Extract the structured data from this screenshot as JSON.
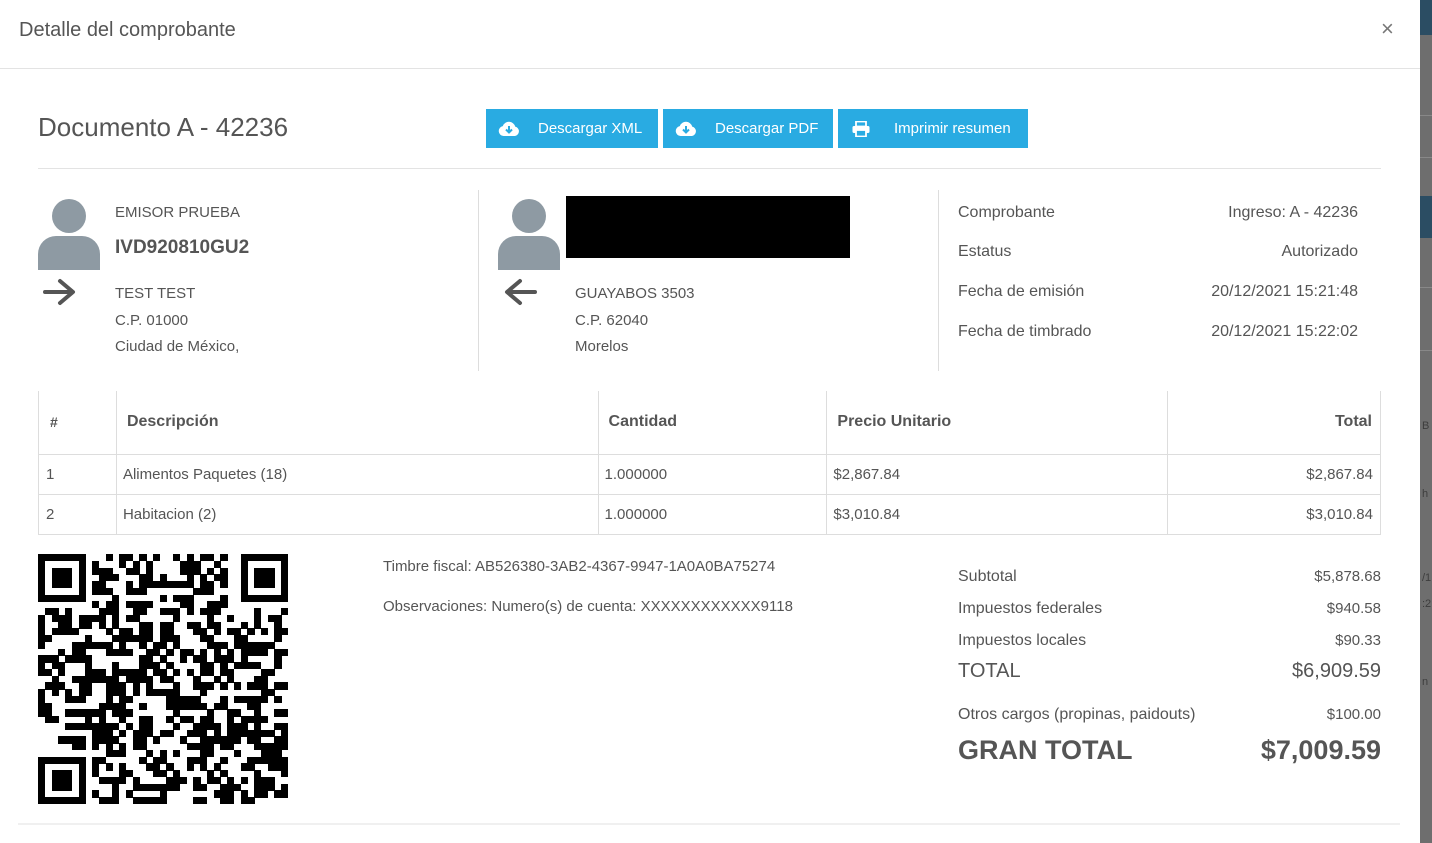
{
  "modal": {
    "title": "Detalle del comprobante",
    "close": "×"
  },
  "document": {
    "title": "Documento A - 42236"
  },
  "buttons": [
    {
      "label": "Descargar XML",
      "icon": "cloud-download-icon"
    },
    {
      "label": "Descargar PDF",
      "icon": "cloud-download-icon"
    },
    {
      "label": "Imprimir resumen",
      "icon": "printer-icon"
    }
  ],
  "colors": {
    "accent": "#29abe2",
    "avatar": "#8e9aa3",
    "text": "#555555"
  },
  "emitter": {
    "name": "EMISOR PRUEBA",
    "rfc": "IVD920810GU2",
    "address1": "TEST TEST",
    "address2": "C.P. 01000",
    "address3": "Ciudad de México,"
  },
  "receiver": {
    "address1": "GUAYABOS 3503",
    "address2": "C.P. 62040",
    "address3": "Morelos"
  },
  "info": [
    {
      "label": "Comprobante",
      "value": "Ingreso: A - 42236"
    },
    {
      "label": "Estatus",
      "value": "Autorizado"
    },
    {
      "label": "Fecha de emisión",
      "value": "20/12/2021 15:21:48"
    },
    {
      "label": "Fecha de timbrado",
      "value": "20/12/2021 15:22:02"
    }
  ],
  "table": {
    "headers": [
      "#",
      "Descripción",
      "Cantidad",
      "Precio Unitario",
      "Total"
    ],
    "rows": [
      [
        "1",
        "Alimentos Paquetes (18)",
        "1.000000",
        "$2,867.84",
        "$2,867.84"
      ],
      [
        "2",
        "Habitacion (2)",
        "1.000000",
        "$3,010.84",
        "$3,010.84"
      ]
    ]
  },
  "meta": {
    "timbre": "Timbre fiscal: AB526380-3AB2-4367-9947-1A0A0BA75274",
    "observaciones": "Observaciones: Numero(s) de cuenta: XXXXXXXXXXXX9118"
  },
  "totals": {
    "subtotal_label": "Subtotal",
    "subtotal": "$5,878.68",
    "federal_label": "Impuestos federales",
    "federal": "$940.58",
    "local_label": "Impuestos locales",
    "local": "$90.33",
    "total_label": "TOTAL",
    "total": "$6,909.59",
    "otros_label": "Otros cargos (propinas, paidouts)",
    "otros": "$100.00",
    "gran_label": "GRAN TOTAL",
    "gran": "$7,009.59"
  },
  "background_fragments": [
    "B",
    "h",
    "/1",
    ":2",
    "n"
  ]
}
